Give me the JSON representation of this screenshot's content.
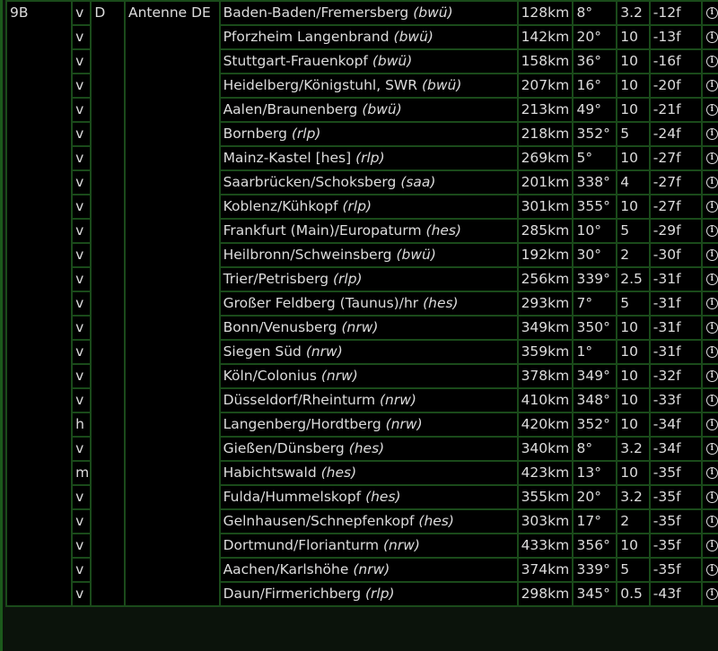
{
  "group": {
    "channel": "9B",
    "mode": "D",
    "operator": "Antenne DE"
  },
  "transmitters": [
    {
      "pol": "v",
      "name": "Baden-Baden/Fremersberg",
      "region": "(bwü)",
      "dist": "128km",
      "az": "8°",
      "power": "3.2",
      "fs": "-12f"
    },
    {
      "pol": "v",
      "name": "Pforzheim Langenbrand",
      "region": "(bwü)",
      "dist": "142km",
      "az": "20°",
      "power": "10",
      "fs": "-13f"
    },
    {
      "pol": "v",
      "name": "Stuttgart-Frauenkopf",
      "region": "(bwü)",
      "dist": "158km",
      "az": "36°",
      "power": "10",
      "fs": "-16f"
    },
    {
      "pol": "v",
      "name": "Heidelberg/Königstuhl, SWR",
      "region": "(bwü)",
      "dist": "207km",
      "az": "16°",
      "power": "10",
      "fs": "-20f"
    },
    {
      "pol": "v",
      "name": "Aalen/Braunenberg",
      "region": "(bwü)",
      "dist": "213km",
      "az": "49°",
      "power": "10",
      "fs": "-21f"
    },
    {
      "pol": "v",
      "name": "Bornberg",
      "region": "(rlp)",
      "dist": "218km",
      "az": "352°",
      "power": "5",
      "fs": "-24f"
    },
    {
      "pol": "v",
      "name": "Mainz-Kastel [hes]",
      "region": "(rlp)",
      "dist": "269km",
      "az": "5°",
      "power": "10",
      "fs": "-27f"
    },
    {
      "pol": "v",
      "name": "Saarbrücken/Schoksberg",
      "region": "(saa)",
      "dist": "201km",
      "az": "338°",
      "power": "4",
      "fs": "-27f"
    },
    {
      "pol": "v",
      "name": "Koblenz/Kühkopf",
      "region": "(rlp)",
      "dist": "301km",
      "az": "355°",
      "power": "10",
      "fs": "-27f"
    },
    {
      "pol": "v",
      "name": "Frankfurt (Main)/Europaturm",
      "region": "(hes)",
      "dist": "285km",
      "az": "10°",
      "power": "5",
      "fs": "-29f"
    },
    {
      "pol": "v",
      "name": "Heilbronn/Schweinsberg",
      "region": "(bwü)",
      "dist": "192km",
      "az": "30°",
      "power": "2",
      "fs": "-30f"
    },
    {
      "pol": "v",
      "name": "Trier/Petrisberg",
      "region": "(rlp)",
      "dist": "256km",
      "az": "339°",
      "power": "2.5",
      "fs": "-31f"
    },
    {
      "pol": "v",
      "name": "Großer Feldberg (Taunus)/hr",
      "region": "(hes)",
      "dist": "293km",
      "az": "7°",
      "power": "5",
      "fs": "-31f"
    },
    {
      "pol": "v",
      "name": "Bonn/Venusberg",
      "region": "(nrw)",
      "dist": "349km",
      "az": "350°",
      "power": "10",
      "fs": "-31f"
    },
    {
      "pol": "v",
      "name": "Siegen Süd",
      "region": "(nrw)",
      "dist": "359km",
      "az": "1°",
      "power": "10",
      "fs": "-31f"
    },
    {
      "pol": "v",
      "name": "Köln/Colonius",
      "region": "(nrw)",
      "dist": "378km",
      "az": "349°",
      "power": "10",
      "fs": "-32f"
    },
    {
      "pol": "v",
      "name": "Düsseldorf/Rheinturm",
      "region": "(nrw)",
      "dist": "410km",
      "az": "348°",
      "power": "10",
      "fs": "-33f"
    },
    {
      "pol": "h",
      "name": "Langenberg/Hordtberg",
      "region": "(nrw)",
      "dist": "420km",
      "az": "352°",
      "power": "10",
      "fs": "-34f"
    },
    {
      "pol": "v",
      "name": "Gießen/Dünsberg",
      "region": "(hes)",
      "dist": "340km",
      "az": "8°",
      "power": "3.2",
      "fs": "-34f"
    },
    {
      "pol": "m",
      "name": "Habichtswald",
      "region": "(hes)",
      "dist": "423km",
      "az": "13°",
      "power": "10",
      "fs": "-35f"
    },
    {
      "pol": "v",
      "name": "Fulda/Hummelskopf",
      "region": "(hes)",
      "dist": "355km",
      "az": "20°",
      "power": "3.2",
      "fs": "-35f"
    },
    {
      "pol": "v",
      "name": "Gelnhausen/Schnepfenkopf",
      "region": "(hes)",
      "dist": "303km",
      "az": "17°",
      "power": "2",
      "fs": "-35f"
    },
    {
      "pol": "v",
      "name": "Dortmund/Florianturm",
      "region": "(nrw)",
      "dist": "433km",
      "az": "356°",
      "power": "10",
      "fs": "-35f"
    },
    {
      "pol": "v",
      "name": "Aachen/Karlshöhe",
      "region": "(nrw)",
      "dist": "374km",
      "az": "339°",
      "power": "5",
      "fs": "-35f"
    },
    {
      "pol": "v",
      "name": "Daun/Firmerichberg",
      "region": "(rlp)",
      "dist": "298km",
      "az": "345°",
      "power": "0.5",
      "fs": "-43f"
    }
  ],
  "icons": {
    "info": "info-icon"
  },
  "colors": {
    "background": "#000000",
    "grid": "#1a4a1a",
    "text": "#dcdcdc"
  }
}
